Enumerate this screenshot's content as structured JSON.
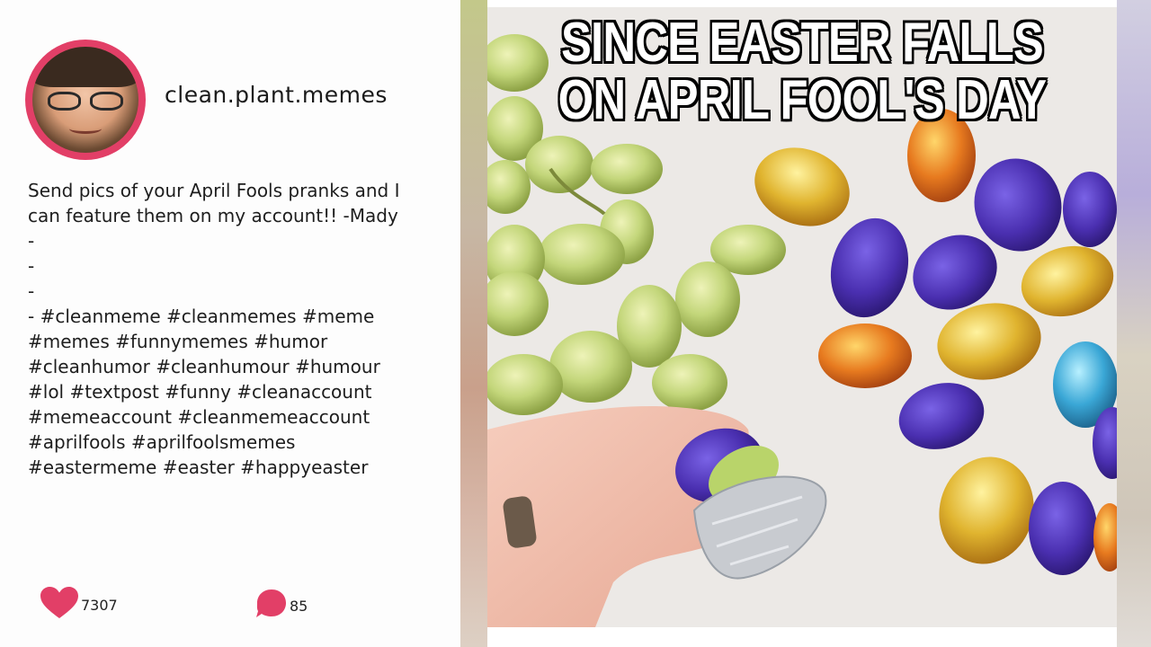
{
  "post": {
    "username": "clean.plant.memes",
    "caption_lines": [
      "Send pics of your April Fools pranks and I",
      "can feature them on my account!! -Mady",
      "-",
      "-",
      "-",
      "- #cleanmeme #cleanmemes #meme",
      "#memes #funnymemes #humor",
      "#cleanhumor #cleanhumour #humour",
      "#lol #textpost #funny #cleanaccount",
      "#memeaccount #cleanmemeaccount",
      "#aprilfools #aprilfoolsmemes",
      "#eastermeme #easter #happyeaster"
    ],
    "likes": "7307",
    "comments": "85"
  },
  "meme": {
    "caption_line1": "SINCE EASTER FALLS",
    "caption_line2": "ON APRIL FOOL'S DAY"
  },
  "icons": {
    "avatar": "avatar-photo",
    "like": "heart-icon",
    "comment": "speech-bubble-icon"
  },
  "colors": {
    "accent": "#e23f67",
    "text": "#1e1e1e"
  }
}
